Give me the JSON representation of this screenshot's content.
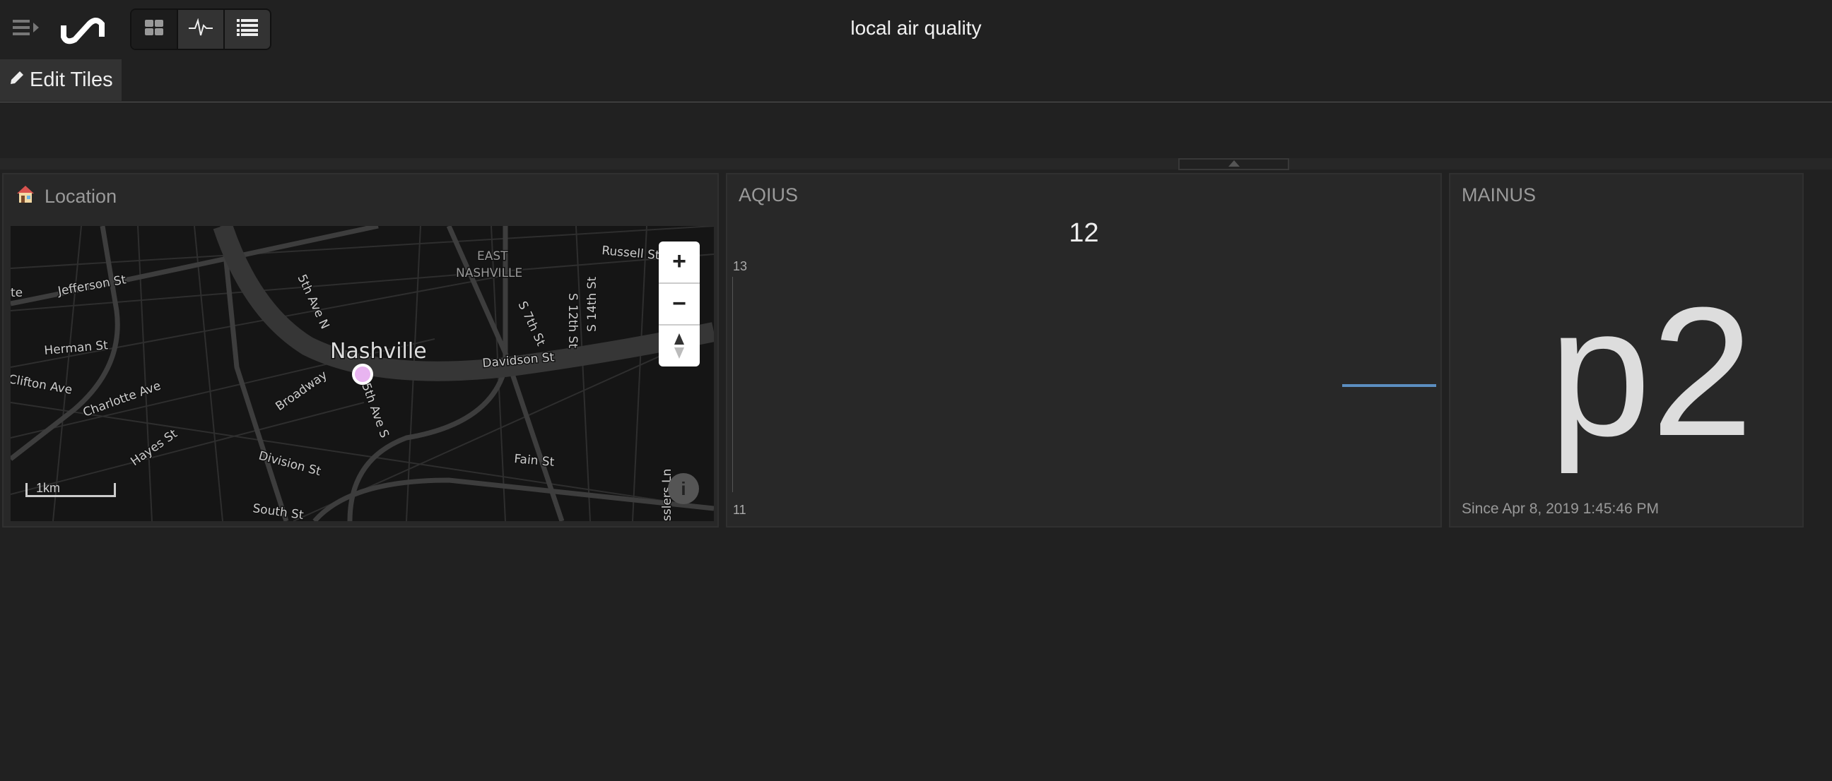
{
  "header": {
    "title": "local air quality",
    "edit_tiles_label": "Edit Tiles"
  },
  "view_buttons": [
    {
      "icon": "grid-icon"
    },
    {
      "icon": "waveform-icon"
    },
    {
      "icon": "list-icon"
    }
  ],
  "tiles": {
    "location": {
      "title": "Location",
      "icon": "house-icon",
      "map": {
        "city": "Nashville",
        "scale": "1km",
        "marker_color": "#e8b4f0",
        "labels": [
          "Jefferson St",
          "Herman St",
          "Clifton Ave",
          "Charlotte Ave",
          "Hayes St",
          "Division St",
          "South St",
          "Broadway",
          "5th Ave N",
          "5th Ave S",
          "EAST",
          "NASHVILLE",
          "Russell St",
          "S 7th St",
          "S 12th St",
          "S 14th St",
          "Davidson St",
          "Fain St",
          "sslers Ln",
          "te"
        ],
        "zoom_in": "+",
        "zoom_out": "−"
      }
    },
    "aqius": {
      "title": "AQIUS",
      "value": "12",
      "y_max_label": "13",
      "y_min_label": "11",
      "line_color": "#5b8ec0"
    },
    "mainus": {
      "title": "MAINUS",
      "value": "p2",
      "since": "Since Apr 8, 2019 1:45:46 PM"
    }
  }
}
